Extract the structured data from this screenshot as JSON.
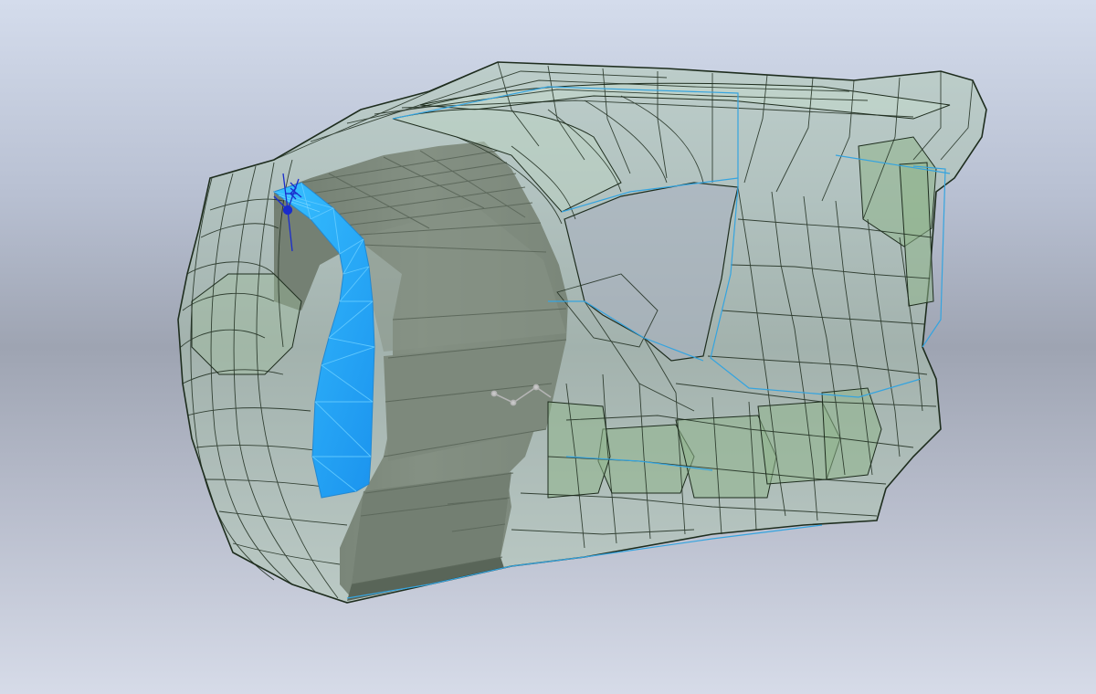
{
  "viewport": {
    "label": "",
    "background_top": "#d4dcec",
    "background_mid": "#9ea4b2",
    "background_bottom": "#d6dbe8"
  },
  "model": {
    "shell_color": "#a8c4a4",
    "shell_edge_color": "#1c2a1c",
    "selected_face_color": "#1aa9ff",
    "solid_body_color": "#5c5c5c",
    "silhouette_color": "#3aa6e0",
    "triad_color": "#1a2ccc",
    "sketch_color": "#b4b4b4"
  }
}
